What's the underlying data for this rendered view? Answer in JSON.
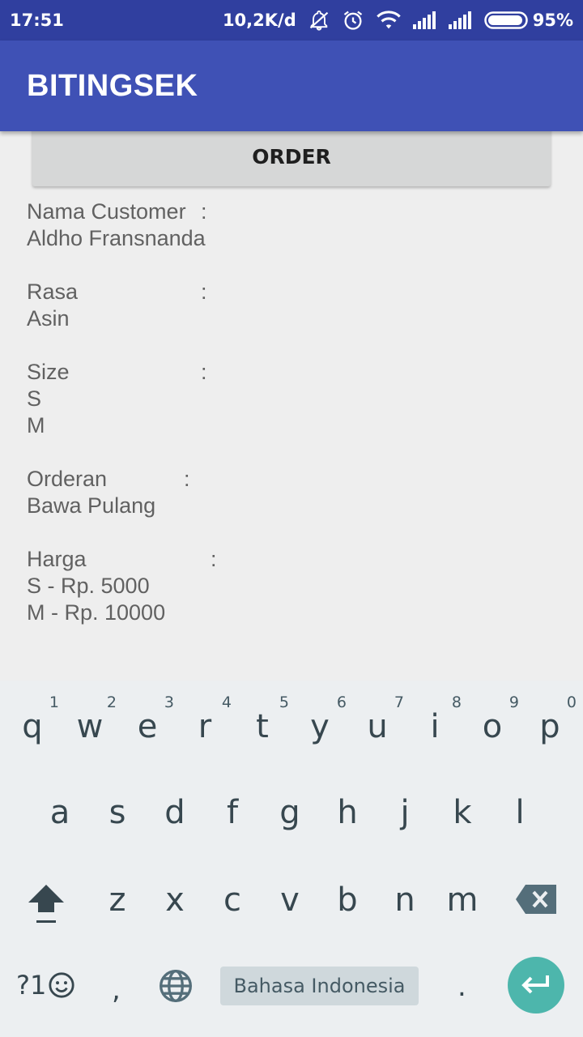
{
  "status_bar": {
    "time": "17:51",
    "network_speed": "10,2K/d",
    "battery": "95%",
    "icons": [
      "notifications-off-icon",
      "alarm-icon",
      "wifi-icon",
      "signal-icon",
      "signal-icon",
      "battery-icon"
    ]
  },
  "app_bar": {
    "title": "BITINGSEK"
  },
  "order_button": {
    "label": "ORDER"
  },
  "details": {
    "customer_label": "Nama Customer",
    "customer_value": "Aldho Fransnanda",
    "rasa_label": "Rasa",
    "rasa_value": "Asin",
    "size_label": "Size",
    "size_values": [
      "S",
      "M"
    ],
    "orderan_label": "Orderan",
    "orderan_value": "Bawa Pulang",
    "harga_label": "Harga",
    "harga_values": [
      "S - Rp. 5000",
      "M - Rp. 10000"
    ],
    "colon": ":"
  },
  "keyboard": {
    "row1": [
      {
        "key": "q",
        "num": "1"
      },
      {
        "key": "w",
        "num": "2"
      },
      {
        "key": "e",
        "num": "3"
      },
      {
        "key": "r",
        "num": "4"
      },
      {
        "key": "t",
        "num": "5"
      },
      {
        "key": "y",
        "num": "6"
      },
      {
        "key": "u",
        "num": "7"
      },
      {
        "key": "i",
        "num": "8"
      },
      {
        "key": "o",
        "num": "9"
      },
      {
        "key": "p",
        "num": "0"
      }
    ],
    "row2": [
      "a",
      "s",
      "d",
      "f",
      "g",
      "h",
      "j",
      "k",
      "l"
    ],
    "row3": [
      "z",
      "x",
      "c",
      "v",
      "b",
      "n",
      "m"
    ],
    "symbols_label": "?1",
    "comma": ",",
    "period": ".",
    "space_label": "Bahasa Indonesia",
    "accent_color": "#4db6ac"
  }
}
